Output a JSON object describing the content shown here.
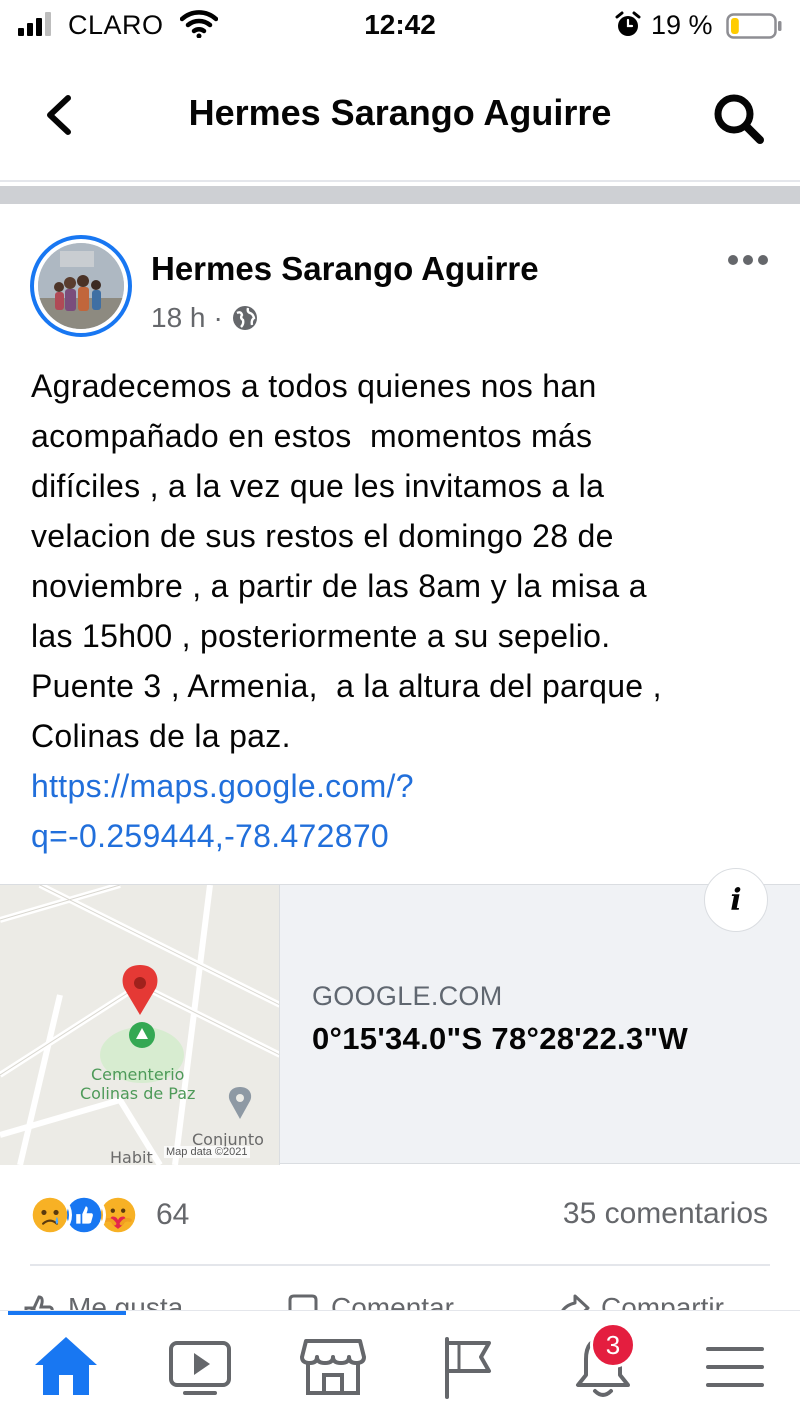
{
  "status_bar": {
    "carrier": "CLARO",
    "time": "12:42",
    "battery_percent": "19 %",
    "battery_level": 0.19
  },
  "header": {
    "title": "Hermes Sarango Aguirre"
  },
  "post": {
    "author": "Hermes Sarango Aguirre",
    "time_ago": "18 h",
    "separator": "·",
    "body_lines": [
      "Agradecemos a todos quienes nos han",
      "acompañado en estos  momentos más",
      "difíciles , a la vez que les invitamos a la",
      "velacion de sus restos el domingo 28 de",
      "noviembre , a partir de las 8am y la misa a",
      "las 15h00 , posteriormente a su sepelio.",
      "Puente 3 , Armenia,  a la altura del parque ,",
      "Colinas de la paz."
    ],
    "link_lines": [
      "https://maps.google.com/?",
      "q=-0.259444,-78.472870"
    ]
  },
  "link_preview": {
    "source": "GOOGLE.COM",
    "title": "0°15'34.0\"S 78°28'22.3\"W",
    "map_labels": {
      "place": "Cementerio\nColinas de Paz",
      "conjunto": "Conjunto",
      "habitat": "Habit",
      "credit": "Map data ©2021"
    }
  },
  "engagement": {
    "reaction_count": "64",
    "comments": "35 comentarios",
    "actions": [
      "Me gusta",
      "Comentar",
      "Compartir"
    ]
  },
  "bottom_nav": {
    "notification_badge": "3"
  },
  "colors": {
    "brand_blue": "#1877f2",
    "link_blue": "#216fdb",
    "badge_red": "#e41e3f",
    "secondary_text": "#65676b"
  }
}
